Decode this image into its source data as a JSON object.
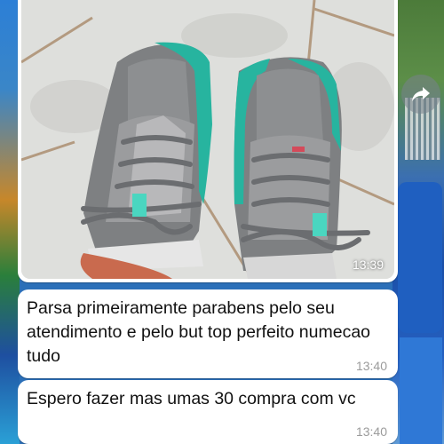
{
  "chat": {
    "messages": [
      {
        "type": "image",
        "description_icon": "sneakers-photo",
        "time": "13:39"
      },
      {
        "type": "text",
        "text": "Parsa primeiramente parabens pelo seu atendimento e pelo but top perfeito numecao tudo",
        "time": "13:40"
      },
      {
        "type": "text",
        "text": "Espero fazer mas umas 30 compra com vc",
        "time": "13:40"
      }
    ],
    "forward_icon": "forward-arrow-icon"
  },
  "colors": {
    "bubble_bg": "#ffffff",
    "text": "#111111",
    "timestamp": "#9b9b9b",
    "teal_accent": "#2fb7a3",
    "wallpaper_blue": "#2b6fb8"
  }
}
